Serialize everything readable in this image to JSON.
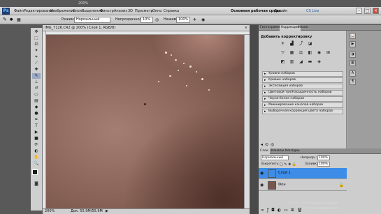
{
  "menubar": {
    "logo": "Ps",
    "items": [
      "Файл",
      "Редактирование",
      "Изображение",
      "Слои",
      "Выделение",
      "Фильтр",
      "Анализ",
      "3D",
      "Просмотр",
      "Окно",
      "Справка"
    ],
    "workspace": "Основная рабочая среда",
    "design": "Дизайн",
    "cslive": "CS Live",
    "zoom": "200%"
  },
  "options": {
    "mode_label": "Режим:",
    "mode_value": "Нормальный",
    "opacity_label": "Непрозрачность:",
    "opacity_value": "10%",
    "flow_label": "Нажим:",
    "flow_value": "100%"
  },
  "document": {
    "tab": "IMG_7126.CR2 @ 200% (Слой 1, RGB/8)",
    "zoom": "200%",
    "doc_info": "Док: 55,9M/55,9M"
  },
  "adjustments": {
    "tabs": [
      "Гистограмма",
      "Коррекция",
      "Маски"
    ],
    "title": "Добавить корректировку",
    "presets": [
      "Уровни наборов",
      "Кривые наборов",
      "Экспозиция наборов",
      "Цветовой тон/Насыщенность наборов",
      "Черно-белое наборов",
      "Микширование каналов наборов",
      "Выборочная коррекция цвета наборов"
    ]
  },
  "layers": {
    "tabs": [
      "Слои",
      "Каналы",
      "Контуры"
    ],
    "blend_mode": "Нормальный",
    "opacity_label": "Непрозр.:",
    "opacity_value": "100%",
    "lock_label": "Закрепить:",
    "fill_label": "Заливка:",
    "fill_value": "100%",
    "items": [
      {
        "name": "Слой 1",
        "selected": true
      },
      {
        "name": "Фон",
        "selected": false
      }
    ]
  },
  "watermark": {
    "line1": "© 2011 Евгений Карташов",
    "line2": "http://photo-monster.ru"
  },
  "colors": {
    "selection": "#3d8de8",
    "panel": "#cdcdcd",
    "skin": "#8c665a"
  }
}
